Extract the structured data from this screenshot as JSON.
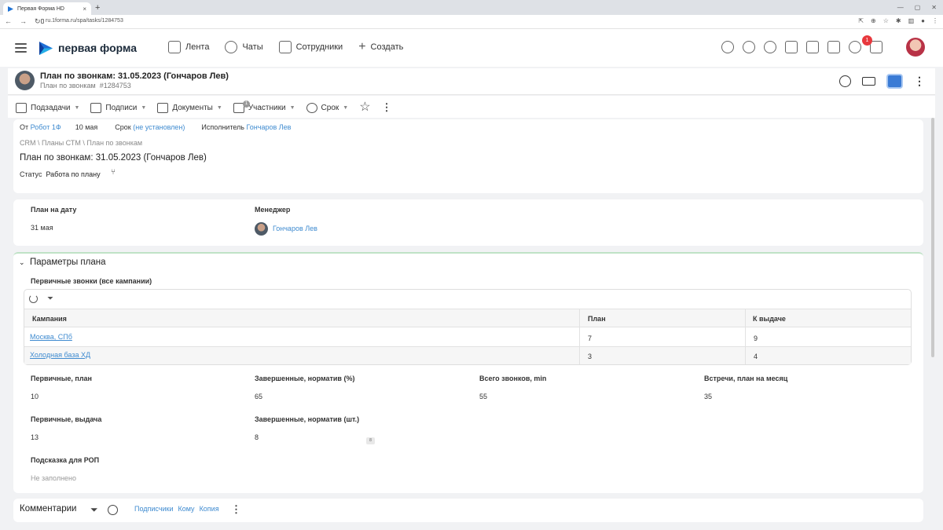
{
  "browser": {
    "tab_title": "Первая Форма HD",
    "tab_close": "×",
    "new_tab": "+",
    "url": "ru.1forma.ru/spa/tasks/1284753"
  },
  "app": {
    "logo_text": "первая форма",
    "nav": [
      {
        "label": "Лента",
        "icon": "feed-icon"
      },
      {
        "label": "Чаты",
        "icon": "chat-icon"
      },
      {
        "label": "Сотрудники",
        "icon": "employees-icon"
      },
      {
        "label": "Создать",
        "icon": "plus-icon"
      }
    ],
    "notification_count": "1"
  },
  "task": {
    "title": "План по звонкам: 31.05.2023 (Гончаров Лев)",
    "type": "План по звонкам",
    "number": "#1284753"
  },
  "toolbar": {
    "subtasks": "Подзадачи",
    "signatures": "Подписи",
    "documents": "Документы",
    "participants": "Участники",
    "participants_count": "1",
    "deadline": "Срок"
  },
  "info": {
    "from_label": "От",
    "from_value": "Робот 1Ф",
    "date": "10 мая",
    "deadline_label": "Срок",
    "deadline_value": "(не установлен)",
    "executor_label": "Исполнитель",
    "executor_value": "Гончаров Лев",
    "breadcrumb": "CRM \\ Планы СТМ \\ План по звонкам",
    "title": "План по звонкам: 31.05.2023 (Гончаров Лев)",
    "status_label": "Статус",
    "status_value": "Работа по плану"
  },
  "plan": {
    "date_label": "План на дату",
    "date_value": "31 мая",
    "manager_label": "Менеджер",
    "manager_value": "Гончаров Лев"
  },
  "params": {
    "section_title": "Параметры плана",
    "table_title": "Первичные звонки (все кампании)",
    "headers": [
      "Кампания",
      "План",
      "К выдаче"
    ],
    "rows": [
      {
        "campaign": "Москва, СПб",
        "plan": "7",
        "issue": "9"
      },
      {
        "campaign": "Холодная база ХД",
        "plan": "3",
        "issue": "4"
      }
    ],
    "fields": [
      {
        "label": "Первичные, план",
        "value": "10"
      },
      {
        "label": "Завершенные, норматив (%)",
        "value": "65"
      },
      {
        "label": "Всего звонков, min",
        "value": "55"
      },
      {
        "label": "Встречи, план на месяц",
        "value": "35"
      },
      {
        "label": "Первичные, выдача",
        "value": "13"
      },
      {
        "label": "Завершенные, норматив (шт.)",
        "value": "8"
      }
    ],
    "hint_label": "Подсказка для РОП",
    "hint_value": "Не заполнено",
    "tiny_marker": "8"
  },
  "comments": {
    "title": "Комментарии",
    "subscribers": "Подписчики",
    "to": "Кому",
    "copy": "Копия"
  }
}
